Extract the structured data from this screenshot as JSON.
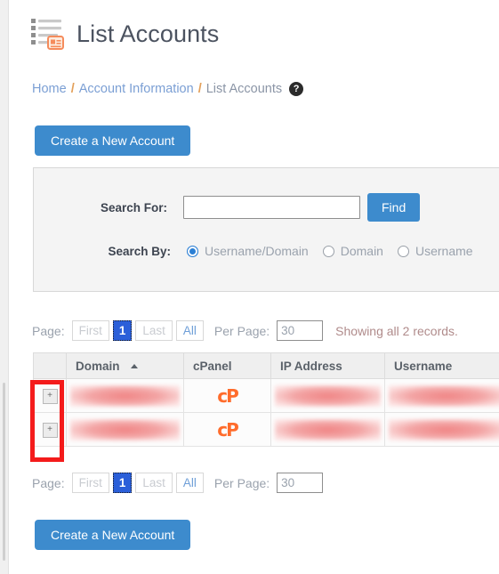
{
  "header": {
    "title": "List Accounts",
    "icon": "list-accounts-icon"
  },
  "breadcrumb": {
    "items": [
      {
        "label": "Home",
        "link": true
      },
      {
        "label": "Account Information",
        "link": true
      },
      {
        "label": "List Accounts",
        "link": false
      }
    ],
    "separator": "/",
    "help_icon": "?"
  },
  "actions": {
    "create_account_top": "Create a New Account",
    "create_account_bottom": "Create a New Account"
  },
  "search_panel": {
    "search_for_label": "Search For:",
    "search_for_value": "",
    "search_for_placeholder": "",
    "find_button": "Find",
    "search_by_label": "Search By:",
    "options": [
      {
        "label": "Username/Domain",
        "selected": true
      },
      {
        "label": "Domain",
        "selected": false
      },
      {
        "label": "Username",
        "selected": false
      }
    ]
  },
  "pagination_top": {
    "page_label": "Page:",
    "first": "First",
    "current": "1",
    "last": "Last",
    "all": "All",
    "per_page_label": "Per Page:",
    "per_page_value": "30",
    "showing": "Showing all 2 records."
  },
  "pagination_bottom": {
    "page_label": "Page:",
    "first": "First",
    "current": "1",
    "last": "Last",
    "all": "All",
    "per_page_label": "Per Page:",
    "per_page_value": "30"
  },
  "table": {
    "columns": [
      {
        "label": "",
        "name": "expand"
      },
      {
        "label": "Domain",
        "name": "domain",
        "sorted": "asc"
      },
      {
        "label": "cPanel",
        "name": "cpanel"
      },
      {
        "label": "IP Address",
        "name": "ip-address"
      },
      {
        "label": "Username",
        "name": "username"
      }
    ],
    "rows": [
      {
        "expand": "+",
        "domain": "",
        "cpanel": "cP",
        "ip": "",
        "username": ""
      },
      {
        "expand": "+",
        "domain": "",
        "cpanel": "cP",
        "ip": "",
        "username": ""
      }
    ]
  },
  "annotation": {
    "color": "#f41b1b",
    "target": "expand-row-buttons"
  },
  "colors": {
    "primary_button": "#3d8bcd",
    "accent_orange": "#ff6c2c",
    "link": "#7b9fd4",
    "active_page": "#2b5fd9",
    "annotation_red": "#f41b1b"
  }
}
